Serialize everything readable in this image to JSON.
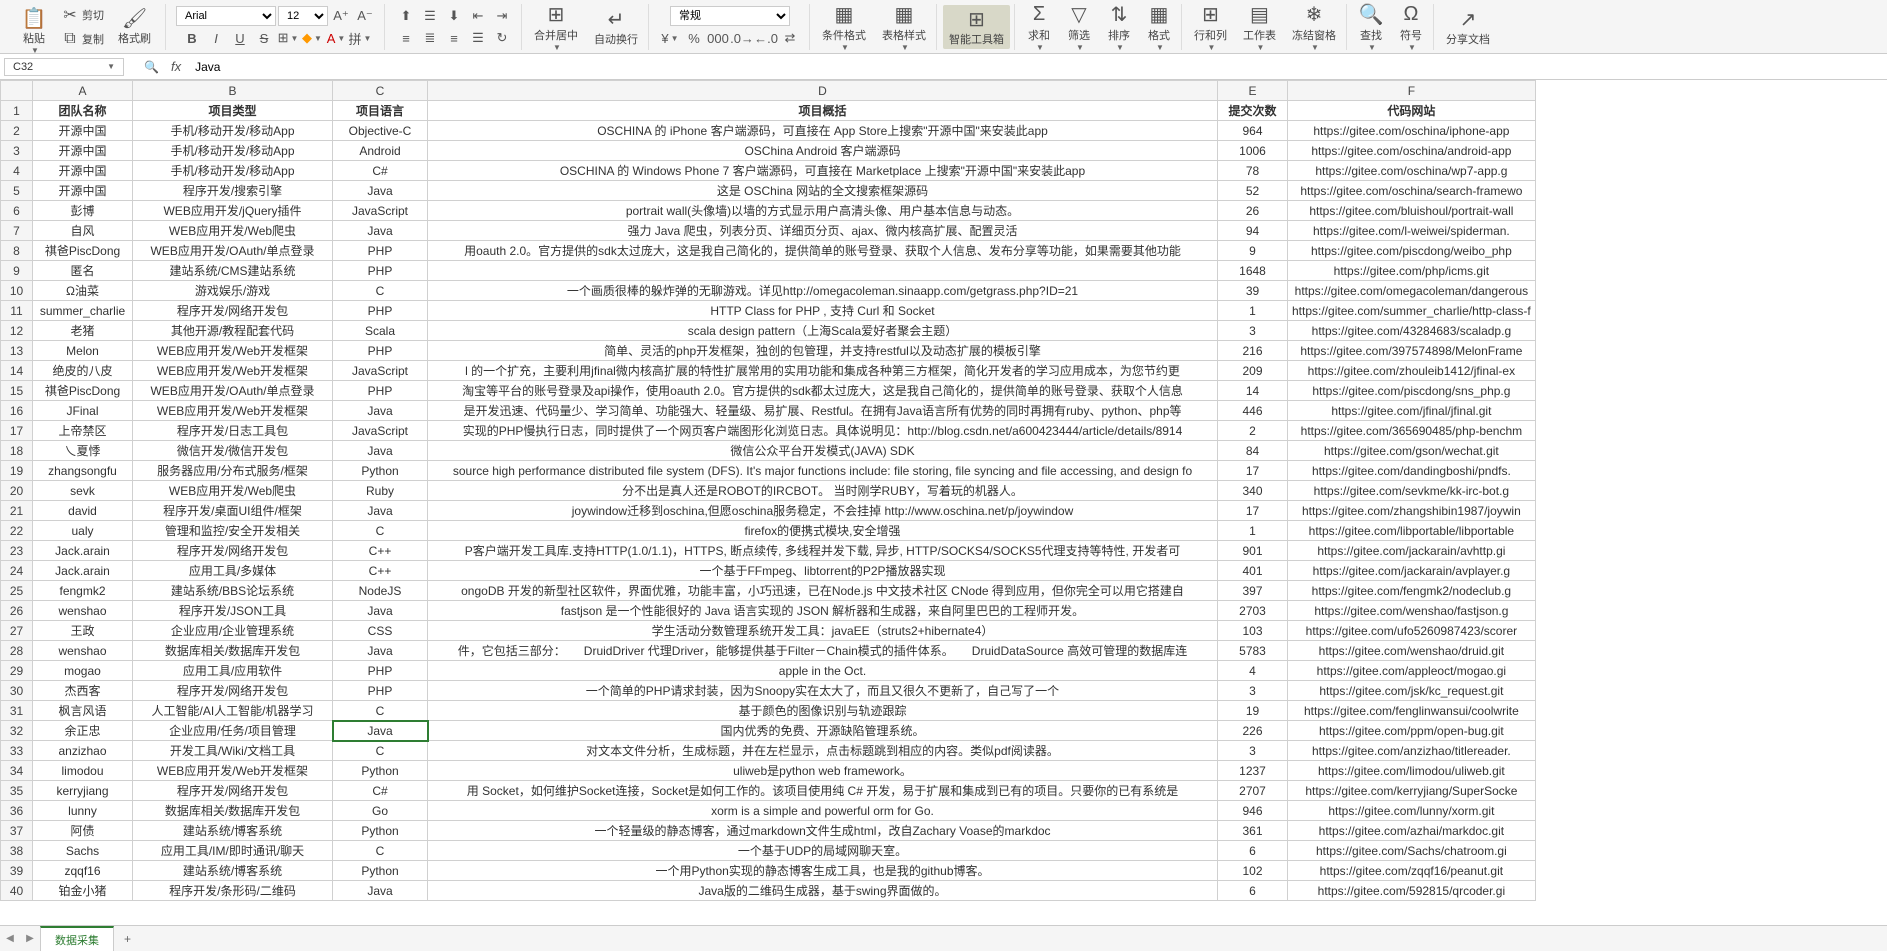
{
  "toolbar": {
    "paste": "粘贴",
    "cut": "剪切",
    "copy": "复制",
    "format_painter": "格式刷",
    "font_name": "Arial",
    "font_size": "12",
    "merge_center": "合并居中",
    "wrap_text": "自动换行",
    "number_format": "常规",
    "cond_format": "条件格式",
    "table_style": "表格样式",
    "smart_tools": "智能工具箱",
    "sum": "求和",
    "filter": "筛选",
    "sort": "排序",
    "format": "格式",
    "row_col": "行和列",
    "worksheet": "工作表",
    "freeze": "冻结窗格",
    "find": "查找",
    "symbol": "符号",
    "share": "分享文档"
  },
  "formula_bar": {
    "cell_ref": "C32",
    "formula_value": "Java"
  },
  "columns": [
    "A",
    "B",
    "C",
    "D",
    "E",
    "F"
  ],
  "header_row": [
    "团队名称",
    "项目类型",
    "项目语言",
    "项目概括",
    "提交次数",
    "代码网站"
  ],
  "active_cell": {
    "row": 32,
    "col": "C"
  },
  "rows": [
    {
      "r": 2,
      "d": [
        "开源中国",
        "手机/移动开发/移动App",
        "Objective-C",
        "OSCHINA 的 iPhone 客户端源码，可直接在 App Store上搜索\"开源中国\"来安装此app",
        "964",
        "https://gitee.com/oschina/iphone-app"
      ]
    },
    {
      "r": 3,
      "d": [
        "开源中国",
        "手机/移动开发/移动App",
        "Android",
        "OSChina Android 客户端源码",
        "1006",
        "https://gitee.com/oschina/android-app"
      ]
    },
    {
      "r": 4,
      "d": [
        "开源中国",
        "手机/移动开发/移动App",
        "C#",
        "OSCHINA 的 Windows Phone 7 客户端源码，可直接在 Marketplace 上搜索\"开源中国\"来安装此app",
        "78",
        "https://gitee.com/oschina/wp7-app.g"
      ]
    },
    {
      "r": 5,
      "d": [
        "开源中国",
        "程序开发/搜索引擎",
        "Java",
        "这是 OSChina 网站的全文搜索框架源码",
        "52",
        "https://gitee.com/oschina/search-framewo"
      ]
    },
    {
      "r": 6,
      "d": [
        "彭博",
        "WEB应用开发/jQuery插件",
        "JavaScript",
        "portrait wall(头像墙)以墙的方式显示用户高清头像、用户基本信息与动态。",
        "26",
        "https://gitee.com/bluishoul/portrait-wall"
      ]
    },
    {
      "r": 7,
      "d": [
        "自风",
        "WEB应用开发/Web爬虫",
        "Java",
        "强力 Java 爬虫，列表分页、详细页分页、ajax、微内核高扩展、配置灵活",
        "94",
        "https://gitee.com/l-weiwei/spiderman."
      ]
    },
    {
      "r": 8,
      "d": [
        "祺爸PiscDong",
        "WEB应用开发/OAuth/单点登录",
        "PHP",
        "用oauth 2.0。官方提供的sdk太过庞大，这是我自己简化的，提供简单的账号登录、获取个人信息、发布分享等功能，如果需要其他功能",
        "9",
        "https://gitee.com/piscdong/weibo_php"
      ]
    },
    {
      "r": 9,
      "d": [
        "匿名",
        "建站系统/CMS建站系统",
        "PHP",
        "",
        "1648",
        "https://gitee.com/php/icms.git"
      ]
    },
    {
      "r": 10,
      "d": [
        "Ω油菜",
        "游戏娱乐/游戏",
        "C",
        "一个画质很棒的躲炸弹的无聊游戏。详见http://omegacoleman.sinaapp.com/getgrass.php?ID=21",
        "39",
        "https://gitee.com/omegacoleman/dangerous"
      ]
    },
    {
      "r": 11,
      "d": [
        "summer_charlie",
        "程序开发/网络开发包",
        "PHP",
        "HTTP Class for PHP , 支持 Curl 和 Socket",
        "1",
        "https://gitee.com/summer_charlie/http-class-f"
      ]
    },
    {
      "r": 12,
      "d": [
        "老猪",
        "其他开源/教程配套代码",
        "Scala",
        "scala design pattern（上海Scala爱好者聚会主题）",
        "3",
        "https://gitee.com/43284683/scaladp.g"
      ]
    },
    {
      "r": 13,
      "d": [
        "Melon",
        "WEB应用开发/Web开发框架",
        "PHP",
        "简单、灵活的php开发框架，独创的包管理，并支持restful以及动态扩展的模板引擎",
        "216",
        "https://gitee.com/397574898/MelonFrame"
      ]
    },
    {
      "r": 14,
      "d": [
        "绝皮的八皮",
        "WEB应用开发/Web开发框架",
        "JavaScript",
        "l 的一个扩充，主要利用jfinal微内核高扩展的特性扩展常用的实用功能和集成各种第三方框架，简化开发者的学习应用成本，为您节约更",
        "209",
        "https://gitee.com/zhouleib1412/jfinal-ex"
      ]
    },
    {
      "r": 15,
      "d": [
        "祺爸PiscDong",
        "WEB应用开发/OAuth/单点登录",
        "PHP",
        "淘宝等平台的账号登录及api操作，使用oauth 2.0。官方提供的sdk都太过庞大，这是我自己简化的，提供简单的账号登录、获取个人信息",
        "14",
        "https://gitee.com/piscdong/sns_php.g"
      ]
    },
    {
      "r": 16,
      "d": [
        "JFinal",
        "WEB应用开发/Web开发框架",
        "Java",
        "是开发迅速、代码量少、学习简单、功能强大、轻量级、易扩展、Restful。在拥有Java语言所有优势的同时再拥有ruby、python、php等",
        "446",
        "https://gitee.com/jfinal/jfinal.git"
      ]
    },
    {
      "r": 17,
      "d": [
        "上帝禁区",
        "程序开发/日志工具包",
        "JavaScript",
        "实现的PHP慢执行日志，同时提供了一个网页客户端图形化浏览日志。具体说明见：http://blog.csdn.net/a600423444/article/details/8914",
        "2",
        "https://gitee.com/365690485/php-benchm"
      ]
    },
    {
      "r": 18,
      "d": [
        "乀夏悸",
        "微信开发/微信开发包",
        "Java",
        "微信公众平台开发模式(JAVA) SDK",
        "84",
        "https://gitee.com/gson/wechat.git"
      ]
    },
    {
      "r": 19,
      "d": [
        "zhangsongfu",
        "服务器应用/分布式服务/框架",
        "Python",
        "source high performance distributed file system (DFS). It's major functions include: file storing, file syncing and file accessing, and design fo",
        "17",
        "https://gitee.com/dandingboshi/pndfs."
      ]
    },
    {
      "r": 20,
      "d": [
        "sevk",
        "WEB应用开发/Web爬虫",
        "Ruby",
        "分不出是真人还是ROBOT的IRCBOT。 当时刚学RUBY，写着玩的机器人。",
        "340",
        "https://gitee.com/sevkme/kk-irc-bot.g"
      ]
    },
    {
      "r": 21,
      "d": [
        "david",
        "程序开发/桌面UI组件/框架",
        "Java",
        "joywindow迁移到oschina,但愿oschina服务稳定，不会挂掉 http://www.oschina.net/p/joywindow",
        "17",
        "https://gitee.com/zhangshibin1987/joywin"
      ]
    },
    {
      "r": 22,
      "d": [
        "ualy",
        "管理和监控/安全开发相关",
        "C",
        "firefox的便携式模块,安全增强",
        "1",
        "https://gitee.com/libportable/libportable"
      ]
    },
    {
      "r": 23,
      "d": [
        "Jack.arain",
        "程序开发/网络开发包",
        "C++",
        "P客户端开发工具库.支持HTTP(1.0/1.1)，HTTPS, 断点续传, 多线程并发下载, 异步, HTTP/SOCKS4/SOCKS5代理支持等特性, 开发者可",
        "901",
        "https://gitee.com/jackarain/avhttp.gi"
      ]
    },
    {
      "r": 24,
      "d": [
        "Jack.arain",
        "应用工具/多媒体",
        "C++",
        "一个基于FFmpeg、libtorrent的P2P播放器实现",
        "401",
        "https://gitee.com/jackarain/avplayer.g"
      ]
    },
    {
      "r": 25,
      "d": [
        "fengmk2",
        "建站系统/BBS论坛系统",
        "NodeJS",
        "ongoDB 开发的新型社区软件，界面优雅，功能丰富，小巧迅速，已在Node.js 中文技术社区 CNode 得到应用，但你完全可以用它搭建自",
        "397",
        "https://gitee.com/fengmk2/nodeclub.g"
      ]
    },
    {
      "r": 26,
      "d": [
        "wenshao",
        "程序开发/JSON工具",
        "Java",
        "fastjson 是一个性能很好的 Java 语言实现的 JSON 解析器和生成器，来自阿里巴巴的工程师开发。",
        "2703",
        "https://gitee.com/wenshao/fastjson.g"
      ]
    },
    {
      "r": 27,
      "d": [
        "王政",
        "企业应用/企业管理系统",
        "CSS",
        "学生活动分数管理系统开发工具：javaEE（struts2+hibernate4）",
        "103",
        "https://gitee.com/ufo5260987423/scorer"
      ]
    },
    {
      "r": 28,
      "d": [
        "wenshao",
        "数据库相关/数据库开发包",
        "Java",
        "件，它包括三部分：　　DruidDriver 代理Driver，能够提供基于Filter－Chain模式的插件体系。　　DruidDataSource 高效可管理的数据库连",
        "5783",
        "https://gitee.com/wenshao/druid.git"
      ]
    },
    {
      "r": 29,
      "d": [
        "mogao",
        "应用工具/应用软件",
        "PHP",
        "apple in the Oct.",
        "4",
        "https://gitee.com/appleoct/mogao.gi"
      ]
    },
    {
      "r": 30,
      "d": [
        "杰西客",
        "程序开发/网络开发包",
        "PHP",
        "一个简单的PHP请求封装，因为Snoopy实在太大了，而且又很久不更新了，自己写了一个",
        "3",
        "https://gitee.com/jsk/kc_request.git"
      ]
    },
    {
      "r": 31,
      "d": [
        "枫言风语",
        "人工智能/AI人工智能/机器学习",
        "C",
        "基于颜色的图像识别与轨迹跟踪",
        "19",
        "https://gitee.com/fenglinwansui/coolwrite"
      ]
    },
    {
      "r": 32,
      "d": [
        "余正忠",
        "企业应用/任务/项目管理",
        "Java",
        "国内优秀的免费、开源缺陷管理系统。",
        "226",
        "https://gitee.com/ppm/open-bug.git"
      ]
    },
    {
      "r": 33,
      "d": [
        "anzizhao",
        "开发工具/Wiki/文档工具",
        "C",
        "对文本文件分析，生成标题，并在左栏显示，点击标题跳到相应的内容。类似pdf阅读器。",
        "3",
        "https://gitee.com/anzizhao/titlereader."
      ]
    },
    {
      "r": 34,
      "d": [
        "limodou",
        "WEB应用开发/Web开发框架",
        "Python",
        "uliweb是python web framework。",
        "1237",
        "https://gitee.com/limodou/uliweb.git"
      ]
    },
    {
      "r": 35,
      "d": [
        "kerryjiang",
        "程序开发/网络开发包",
        "C#",
        "用 Socket，如何维护Socket连接，Socket是如何工作的。该项目使用纯 C# 开发，易于扩展和集成到已有的项目。只要你的已有系统是",
        "2707",
        "https://gitee.com/kerryjiang/SuperSocke"
      ]
    },
    {
      "r": 36,
      "d": [
        "lunny",
        "数据库相关/数据库开发包",
        "Go",
        "xorm is a simple and powerful orm for Go.",
        "946",
        "https://gitee.com/lunny/xorm.git"
      ]
    },
    {
      "r": 37,
      "d": [
        "阿债",
        "建站系统/博客系统",
        "Python",
        "一个轻量级的静态博客，通过markdown文件生成html，改自Zachary Voase的markdoc",
        "361",
        "https://gitee.com/azhai/markdoc.git"
      ]
    },
    {
      "r": 38,
      "d": [
        "Sachs",
        "应用工具/IM/即时通讯/聊天",
        "C",
        "一个基于UDP的局域网聊天室。",
        "6",
        "https://gitee.com/Sachs/chatroom.gi"
      ]
    },
    {
      "r": 39,
      "d": [
        "zqqf16",
        "建站系统/博客系统",
        "Python",
        "一个用Python实现的静态博客生成工具，也是我的github博客。",
        "102",
        "https://gitee.com/zqqf16/peanut.git"
      ]
    },
    {
      "r": 40,
      "d": [
        "铂金小猪",
        "程序开发/条形码/二维码",
        "Java",
        "Java版的二维码生成器，基于swing界面做的。",
        "6",
        "https://gitee.com/592815/qrcoder.gi"
      ]
    }
  ],
  "sheet_tabs": {
    "active": "数据采集",
    "add": "+"
  }
}
